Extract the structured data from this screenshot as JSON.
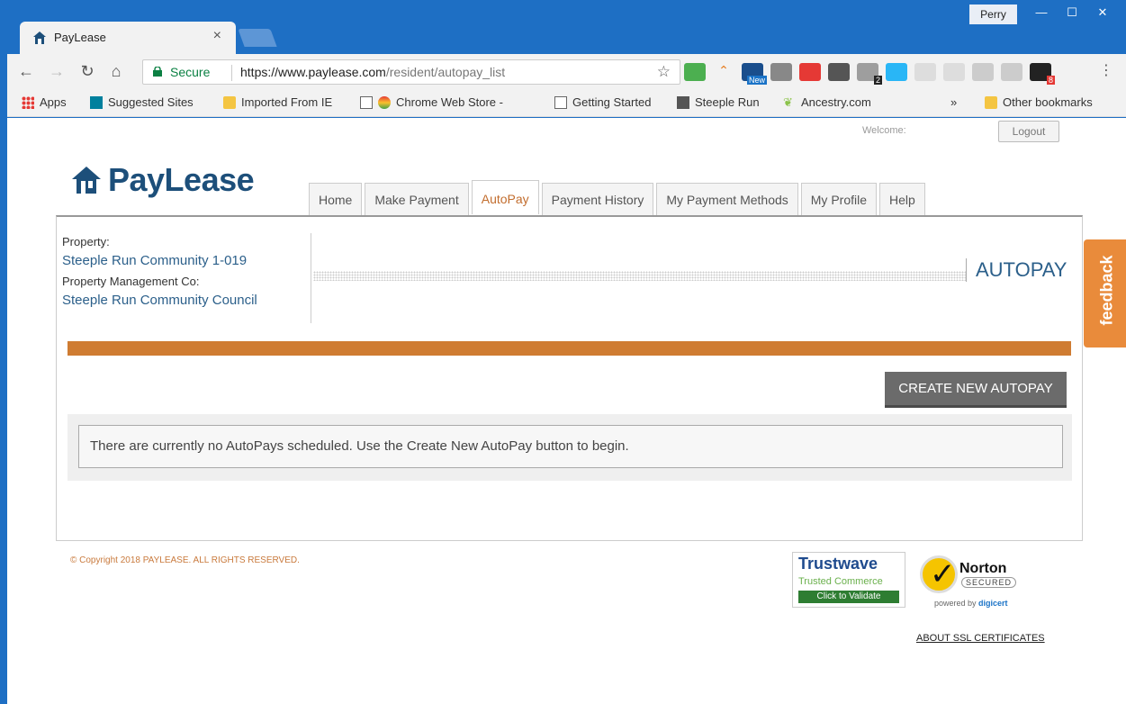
{
  "browser": {
    "tab_title": "PayLease",
    "tab_close": "×",
    "user": "Perry",
    "window_controls": [
      "—",
      "☐",
      "✕"
    ],
    "secure_label": "Secure",
    "url_host": "https://www.paylease.com",
    "url_path": "/resident/autopay_list",
    "ext_badge_count": "2",
    "ext_new_badge": "New",
    "ext_amazon_badge": "8"
  },
  "bookmarks": [
    {
      "label": "Apps"
    },
    {
      "label": "Suggested Sites"
    },
    {
      "label": "Imported From IE"
    },
    {
      "label": "Chrome Web Store -"
    },
    {
      "label": "Getting Started"
    },
    {
      "label": "Steeple Run"
    },
    {
      "label": "Ancestry.com"
    }
  ],
  "bookmarks_more": "»",
  "bookmarks_other": "Other bookmarks",
  "header": {
    "welcome": "Welcome:",
    "logout": "Logout",
    "logo": "PayLease"
  },
  "nav": [
    {
      "label": "Home"
    },
    {
      "label": "Make Payment"
    },
    {
      "label": "AutoPay"
    },
    {
      "label": "Payment History"
    },
    {
      "label": "My Payment Methods"
    },
    {
      "label": "My Profile"
    },
    {
      "label": "Help"
    }
  ],
  "property": {
    "property_label": "Property:",
    "property_value": "Steeple Run Community 1-019",
    "mgmt_label": "Property Management Co:",
    "mgmt_value": "Steeple Run Community Council"
  },
  "section_title": "AUTOPAY",
  "create_button": "CREATE NEW AUTOPAY",
  "empty_message": "There are currently no AutoPays scheduled. Use the Create New AutoPay button to begin.",
  "footer": {
    "copyright": "© Copyright 2018 PAYLEASE. ALL RIGHTS RESERVED.",
    "trustwave_name": "Trustwave",
    "trustwave_sub": "Trusted Commerce",
    "trustwave_click": "Click to Validate",
    "norton_name": "Norton",
    "norton_secured": "SECURED",
    "norton_powered": "powered by",
    "norton_digicert": "digicert",
    "ssl_link": "ABOUT SSL CERTIFICATES"
  },
  "feedback": "feedback",
  "colors": {
    "accent_orange": "#cf7c32",
    "brand_blue": "#1d4f7a",
    "link_blue": "#2b5f8a",
    "chrome_blue": "#1e6fc4"
  }
}
